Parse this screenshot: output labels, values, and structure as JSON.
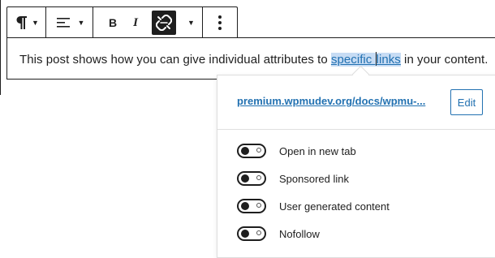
{
  "toolbar": {
    "paragraph_icon": "pilcrow-icon",
    "align_icon": "align-left-icon",
    "bold_label": "B",
    "italic_label": "I",
    "unlink_icon": "unlink-icon",
    "more_icon": "more-vertical-icon"
  },
  "content": {
    "text_before": "This post shows how you can give individual attributes to ",
    "link_part1": "specific ",
    "link_part2": "links",
    "text_after": " in your content."
  },
  "popover": {
    "url": "premium.wpmudev.org/docs/wpmu-...",
    "edit_label": "Edit",
    "options": [
      {
        "label": "Open in new tab",
        "checked": false
      },
      {
        "label": "Sponsored link",
        "checked": false
      },
      {
        "label": "User generated content",
        "checked": false
      },
      {
        "label": "Nofollow",
        "checked": false
      }
    ]
  },
  "colors": {
    "link": "#2271b1",
    "link_highlight": "#c7dcf4",
    "dark": "#1e1e1e"
  }
}
